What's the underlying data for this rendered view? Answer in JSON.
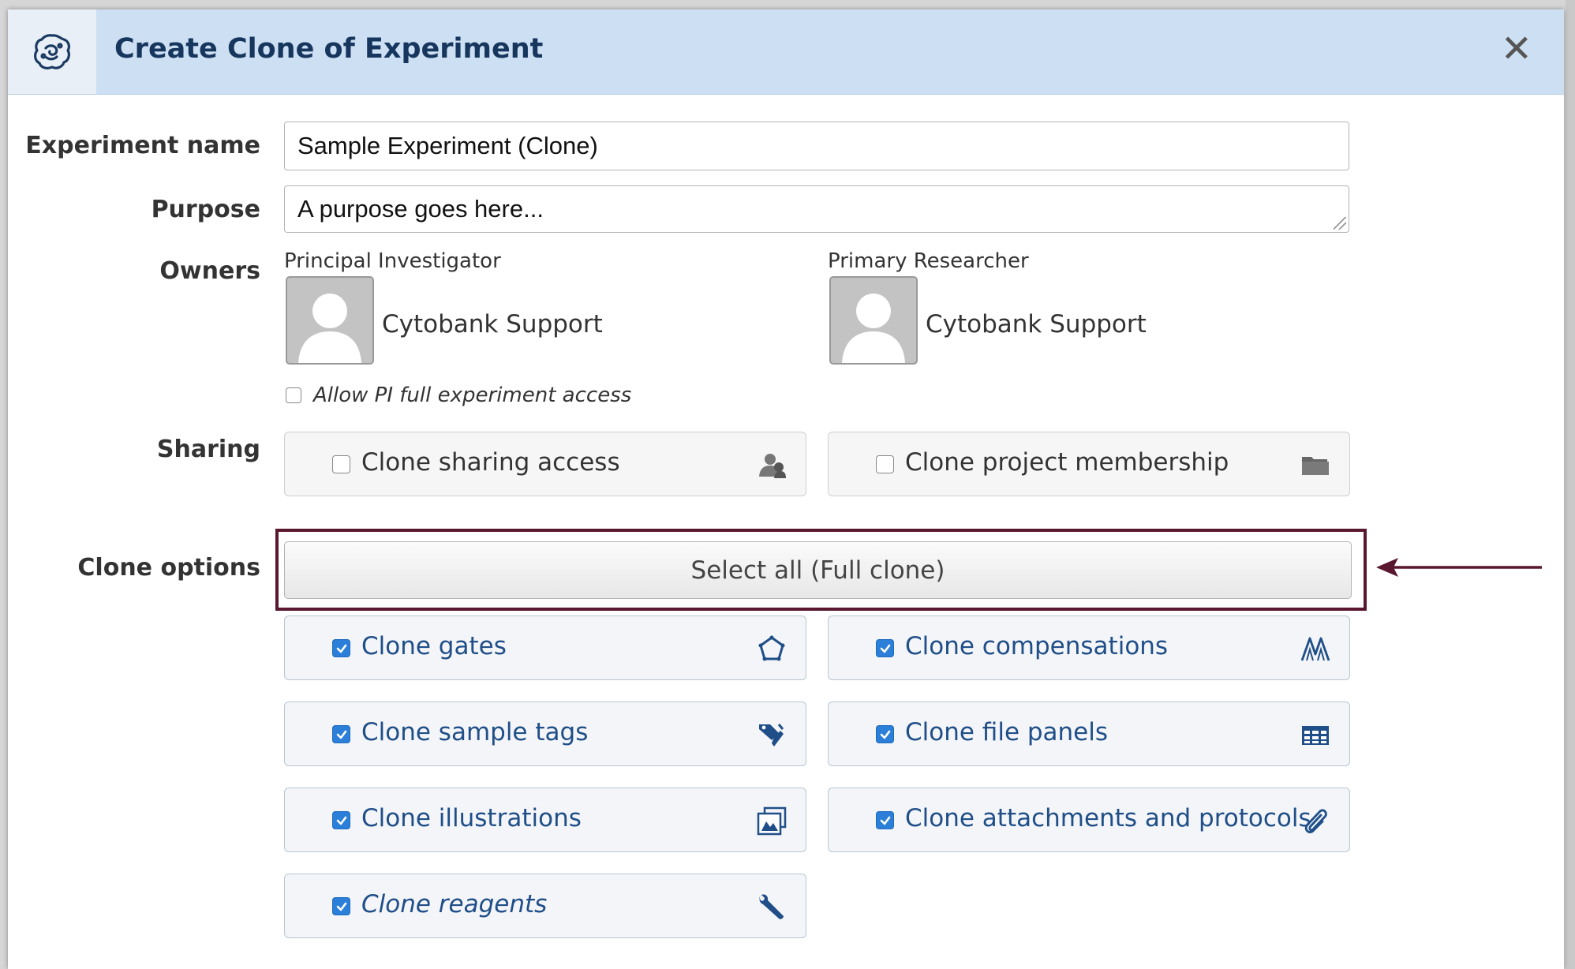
{
  "dialog": {
    "title": "Create Clone of Experiment",
    "close_label": "✕"
  },
  "form": {
    "experiment_name": {
      "label": "Experiment name",
      "value": "Sample Experiment (Clone)"
    },
    "purpose": {
      "label": "Purpose",
      "value": "A purpose goes here..."
    },
    "owners": {
      "label": "Owners",
      "pi": {
        "role": "Principal Investigator",
        "name": "Cytobank Support"
      },
      "researcher": {
        "role": "Primary Researcher",
        "name": "Cytobank Support"
      },
      "allow_pi_access": {
        "label": "Allow PI full experiment access",
        "checked": false
      }
    },
    "sharing": {
      "label": "Sharing",
      "options": [
        {
          "label": "Clone sharing access",
          "checked": false,
          "icon": "user-share-icon"
        },
        {
          "label": "Clone project membership",
          "checked": false,
          "icon": "folder-icon"
        }
      ]
    },
    "clone_options": {
      "label": "Clone options",
      "select_all_label": "Select all (Full clone)",
      "options": [
        {
          "label": "Clone gates",
          "checked": true,
          "icon": "pentagon-gate-icon"
        },
        {
          "label": "Clone compensations",
          "checked": true,
          "icon": "compensation-peaks-icon"
        },
        {
          "label": "Clone sample tags",
          "checked": true,
          "icon": "tag-icon"
        },
        {
          "label": "Clone file panels",
          "checked": true,
          "icon": "table-grid-icon"
        },
        {
          "label": "Clone illustrations",
          "checked": true,
          "icon": "illustrations-icon"
        },
        {
          "label": "Clone attachments and protocols",
          "checked": true,
          "icon": "paperclip-icon"
        },
        {
          "label": "Clone reagents",
          "checked": true,
          "icon": "wrench-icon"
        }
      ]
    }
  },
  "colors": {
    "header_bg": "#cddff2",
    "title": "#16365e",
    "checkbox_on": "#2c7fd8",
    "option_text": "#1f4e88",
    "highlight_border": "#5a1730"
  }
}
